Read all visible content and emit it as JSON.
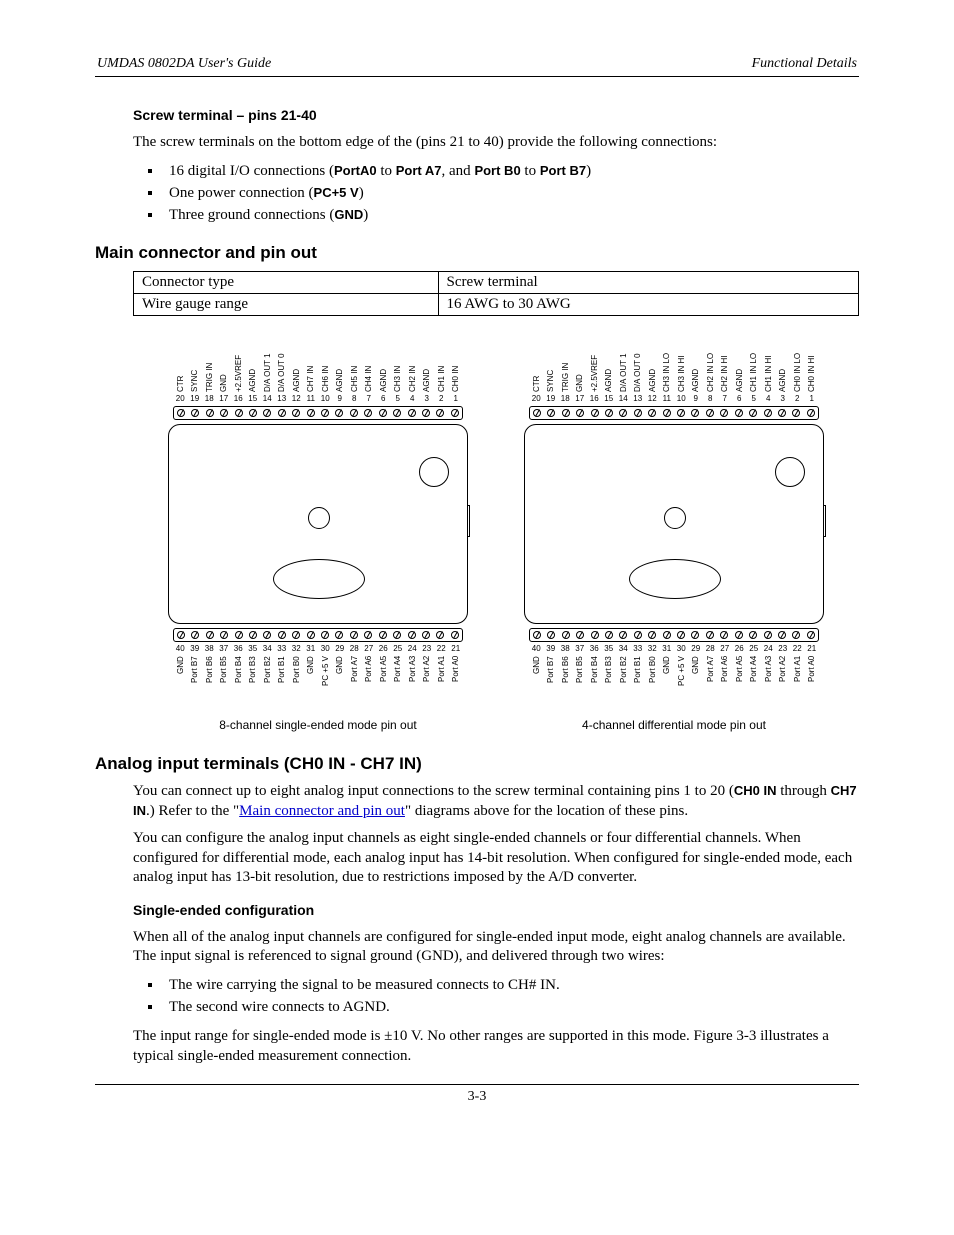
{
  "header": {
    "left": "UMDAS 0802DA User's Guide",
    "right": "Functional Details"
  },
  "section_screw": {
    "title": "Screw terminal – pins 21-40",
    "intro": "The screw terminals on the bottom edge of the (pins 21 to 40) provide the following connections:",
    "bullets": {
      "b1_pre": "16 digital I/O connections (",
      "b1_s1": "PortA0",
      "b1_mid1": " to ",
      "b1_s2": "Port A7",
      "b1_mid2": ", and ",
      "b1_s3": "Port B0",
      "b1_mid3": " to ",
      "b1_s4": "Port B7",
      "b1_post": ")",
      "b2_pre": "One power connection (",
      "b2_s1": "PC+5 V",
      "b2_post": ")",
      "b3_pre": "Three ground connections (",
      "b3_s1": "GND",
      "b3_post": ")"
    }
  },
  "section_connector": {
    "title": "Main connector and pin out",
    "table": {
      "r1c1": "Connector type",
      "r1c2": "Screw terminal",
      "r2c1": "Wire gauge range",
      "r2c2": "16 AWG to 30 AWG"
    }
  },
  "diagrams": {
    "se": {
      "caption": "8-channel single-ended mode pin out",
      "top": [
        {
          "n": "20",
          "name": "CTR"
        },
        {
          "n": "19",
          "name": "SYNC"
        },
        {
          "n": "18",
          "name": "TRIG IN"
        },
        {
          "n": "17",
          "name": "GND"
        },
        {
          "n": "16",
          "name": "+2.5VREF"
        },
        {
          "n": "15",
          "name": "AGND"
        },
        {
          "n": "14",
          "name": "D/A OUT 1"
        },
        {
          "n": "13",
          "name": "D/A OUT 0"
        },
        {
          "n": "12",
          "name": "AGND"
        },
        {
          "n": "11",
          "name": "CH7 IN"
        },
        {
          "n": "10",
          "name": "CH6 IN"
        },
        {
          "n": "9",
          "name": "AGND"
        },
        {
          "n": "8",
          "name": "CH5 IN"
        },
        {
          "n": "7",
          "name": "CH4 IN"
        },
        {
          "n": "6",
          "name": "AGND"
        },
        {
          "n": "5",
          "name": "CH3 IN"
        },
        {
          "n": "4",
          "name": "CH2 IN"
        },
        {
          "n": "3",
          "name": "AGND"
        },
        {
          "n": "2",
          "name": "CH1 IN"
        },
        {
          "n": "1",
          "name": "CH0 IN"
        }
      ],
      "bottom": [
        {
          "n": "40",
          "name": "GND"
        },
        {
          "n": "39",
          "name": "Port B7"
        },
        {
          "n": "38",
          "name": "Port B6"
        },
        {
          "n": "37",
          "name": "Port B5"
        },
        {
          "n": "36",
          "name": "Port B4"
        },
        {
          "n": "35",
          "name": "Port B3"
        },
        {
          "n": "34",
          "name": "Port B2"
        },
        {
          "n": "33",
          "name": "Port B1"
        },
        {
          "n": "32",
          "name": "Port B0"
        },
        {
          "n": "31",
          "name": "GND"
        },
        {
          "n": "30",
          "name": "PC +5 V"
        },
        {
          "n": "29",
          "name": "GND"
        },
        {
          "n": "28",
          "name": "Port A7"
        },
        {
          "n": "27",
          "name": "Port A6"
        },
        {
          "n": "26",
          "name": "Port A5"
        },
        {
          "n": "25",
          "name": "Port A4"
        },
        {
          "n": "24",
          "name": "Port A3"
        },
        {
          "n": "23",
          "name": "Port A2"
        },
        {
          "n": "22",
          "name": "Port A1"
        },
        {
          "n": "21",
          "name": "Port A0"
        }
      ]
    },
    "diff": {
      "caption": "4-channel differential mode pin out",
      "top": [
        {
          "n": "20",
          "name": "CTR"
        },
        {
          "n": "19",
          "name": "SYNC"
        },
        {
          "n": "18",
          "name": "TRIG IN"
        },
        {
          "n": "17",
          "name": "GND"
        },
        {
          "n": "16",
          "name": "+2.5VREF"
        },
        {
          "n": "15",
          "name": "AGND"
        },
        {
          "n": "14",
          "name": "D/A OUT 1"
        },
        {
          "n": "13",
          "name": "D/A OUT 0"
        },
        {
          "n": "12",
          "name": "AGND"
        },
        {
          "n": "11",
          "name": "CH3 IN LO"
        },
        {
          "n": "10",
          "name": "CH3 IN HI"
        },
        {
          "n": "9",
          "name": "AGND"
        },
        {
          "n": "8",
          "name": "CH2 IN LO"
        },
        {
          "n": "7",
          "name": "CH2 IN HI"
        },
        {
          "n": "6",
          "name": "AGND"
        },
        {
          "n": "5",
          "name": "CH1 IN LO"
        },
        {
          "n": "4",
          "name": "CH1 IN HI"
        },
        {
          "n": "3",
          "name": "AGND"
        },
        {
          "n": "2",
          "name": "CH0 IN LO"
        },
        {
          "n": "1",
          "name": "CH0 IN HI"
        }
      ],
      "bottom": [
        {
          "n": "40",
          "name": "GND"
        },
        {
          "n": "39",
          "name": "Port B7"
        },
        {
          "n": "38",
          "name": "Port B6"
        },
        {
          "n": "37",
          "name": "Port B5"
        },
        {
          "n": "36",
          "name": "Port B4"
        },
        {
          "n": "35",
          "name": "Port B3"
        },
        {
          "n": "34",
          "name": "Port B2"
        },
        {
          "n": "33",
          "name": "Port B1"
        },
        {
          "n": "32",
          "name": "Port B0"
        },
        {
          "n": "31",
          "name": "GND"
        },
        {
          "n": "30",
          "name": "PC +5 V"
        },
        {
          "n": "29",
          "name": "GND"
        },
        {
          "n": "28",
          "name": "Port A7"
        },
        {
          "n": "27",
          "name": "Port A6"
        },
        {
          "n": "26",
          "name": "Port A5"
        },
        {
          "n": "25",
          "name": "Port A4"
        },
        {
          "n": "24",
          "name": "Port A3"
        },
        {
          "n": "23",
          "name": "Port A2"
        },
        {
          "n": "22",
          "name": "Port A1"
        },
        {
          "n": "21",
          "name": "Port A0"
        }
      ]
    }
  },
  "section_analog": {
    "title": "Analog input terminals (CH0 IN - CH7 IN)",
    "p1_a": "You can connect up to eight analog input connections to the screw terminal containing pins 1 to 20 (",
    "p1_s1": "CH0 IN",
    "p1_b": " through ",
    "p1_s2": "CH7 IN",
    "p1_c": ".) Refer to the \"",
    "p1_link": "Main connector and pin out",
    "p1_d": "\" diagrams above for the location of these pins.",
    "p2": "You can configure the analog input channels as eight single-ended channels or four differential channels. When configured for differential mode, each analog input has 14-bit resolution. When configured for single-ended mode, each analog input has 13-bit resolution, due to restrictions imposed by the A/D converter."
  },
  "section_se_config": {
    "title": "Single-ended configuration",
    "p1": "When all of the analog input channels are configured for single-ended input mode, eight analog channels are available. The input signal is referenced to signal ground (GND), and delivered through two wires:",
    "b1": "The wire carrying the signal to be measured connects to CH# IN.",
    "b2": "The second wire connects to AGND.",
    "p2": "The input range for single-ended mode is ±10 V. No other ranges are supported in this mode. Figure 3-3 illustrates a typical single-ended measurement connection."
  },
  "footer": {
    "page": "3-3"
  }
}
